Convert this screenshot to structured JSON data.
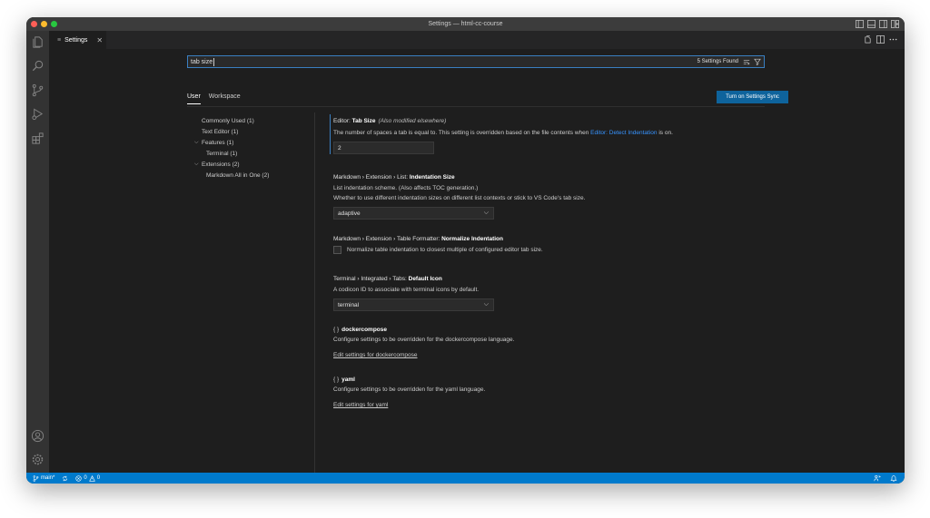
{
  "window": {
    "title": "Settings — html-cc-course",
    "traffic_colors": [
      "#ff5f57",
      "#febc2e",
      "#28c840"
    ]
  },
  "tab": {
    "icon": "settings-lines-icon",
    "label": "Settings",
    "close": "✕"
  },
  "search": {
    "value": "tab size",
    "found": "5 Settings Found"
  },
  "scope_tabs": {
    "user": "User",
    "workspace": "Workspace"
  },
  "sync_button": "Turn on Settings Sync",
  "toc": {
    "commonly_used": "Commonly Used (1)",
    "text_editor": "Text Editor (1)",
    "features": "Features (1)",
    "terminal": "Terminal (1)",
    "extensions": "Extensions (2)",
    "markdown_all_in_one": "Markdown All in One (2)"
  },
  "settings": {
    "tab_size": {
      "prefix": "Editor: ",
      "name": "Tab Size",
      "note": "(Also modified elsewhere)",
      "desc_before": "The number of spaces a tab is equal to. This setting is overridden based on the file contents when ",
      "desc_link": "Editor: Detect Indentation",
      "desc_after": " is on.",
      "value": "2"
    },
    "list_indent": {
      "prefix": "Markdown › Extension › List: ",
      "name": "Indentation Size",
      "desc1": "List indentation scheme. (Also affects TOC generation.)",
      "desc2": "Whether to use different indentation sizes on different list contexts or stick to VS Code's tab size.",
      "value": "adaptive"
    },
    "table_formatter": {
      "prefix": "Markdown › Extension › Table Formatter: ",
      "name": "Normalize Indentation",
      "checkbox_label": "Normalize table indentation to closest multiple of configured editor tab size."
    },
    "terminal_icon": {
      "prefix": "Terminal › Integrated › Tabs: ",
      "name": "Default Icon",
      "desc": "A codicon ID to associate with terminal icons by default.",
      "value": "terminal"
    },
    "dockercompose": {
      "brace": "{ }",
      "name": "dockercompose",
      "desc": "Configure settings to be overridden for the dockercompose language.",
      "link": "Edit settings for dockercompose"
    },
    "yaml": {
      "brace": "{ }",
      "name": "yaml",
      "desc": "Configure settings to be overridden for the yaml language.",
      "link": "Edit settings for yaml"
    }
  },
  "statusbar": {
    "branch": "main*",
    "errors": "0",
    "warnings": "0"
  },
  "colors": {
    "accent": "#007acc",
    "button": "#0e639c",
    "link": "#3794ff",
    "focus": "#3a7fc1"
  }
}
